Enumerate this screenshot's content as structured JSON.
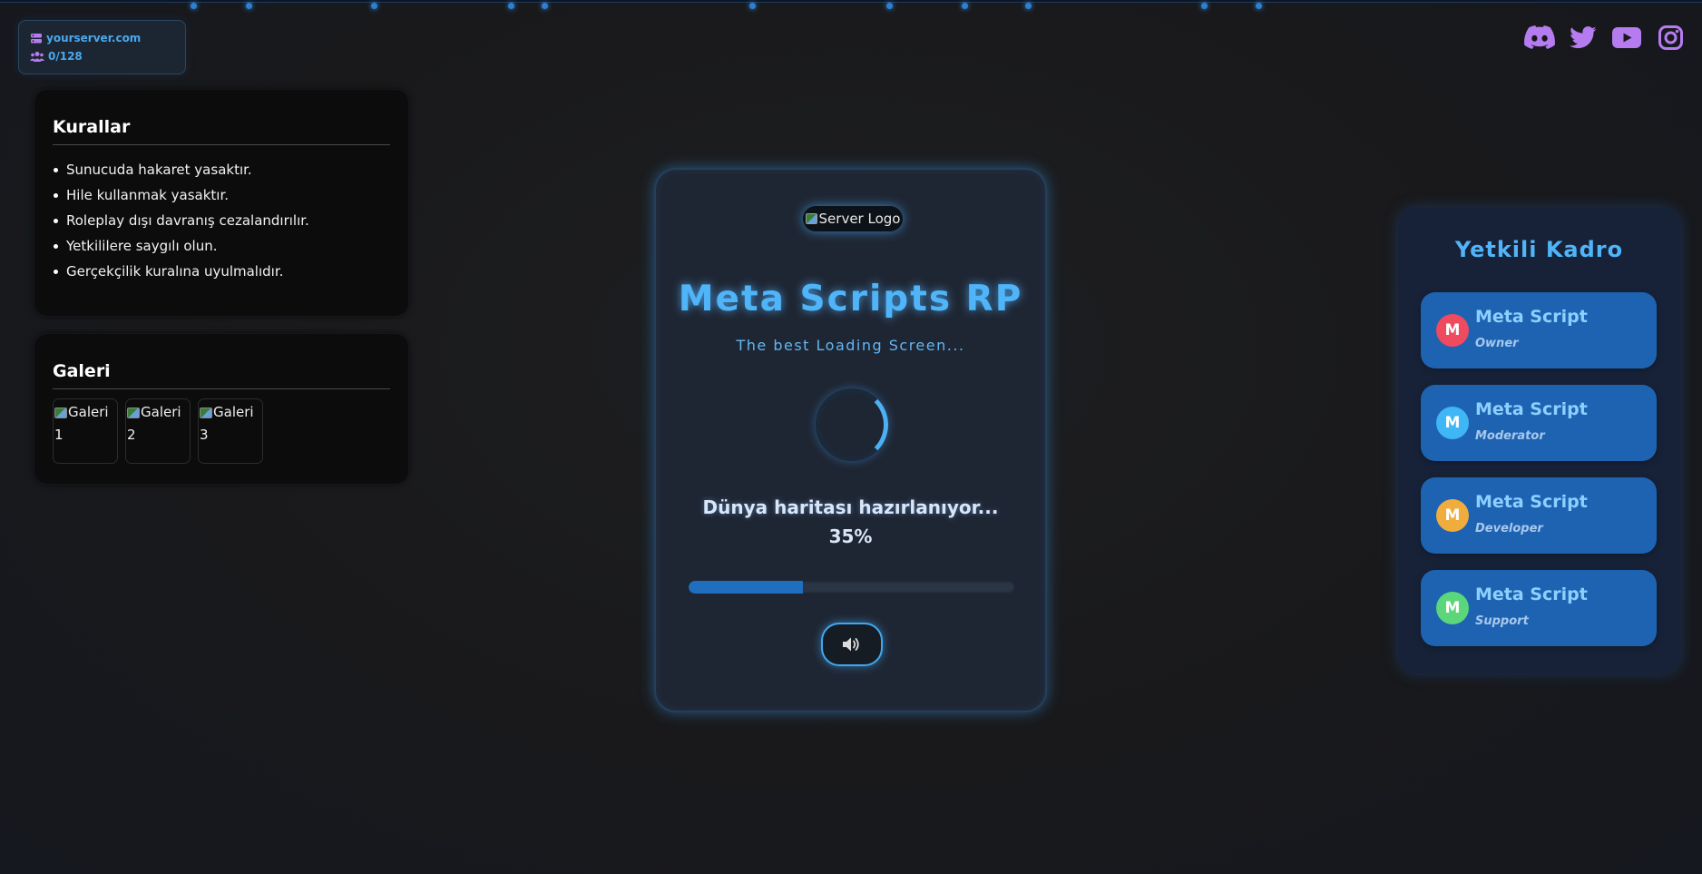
{
  "server_info": {
    "address": "yourserver.com",
    "players": "0/128"
  },
  "social": {
    "items": [
      {
        "name": "discord",
        "color": "#b57cf0"
      },
      {
        "name": "twitter",
        "color": "#b57cf0"
      },
      {
        "name": "youtube",
        "color": "#b57cf0"
      },
      {
        "name": "instagram",
        "color": "#b57cf0"
      }
    ]
  },
  "rules": {
    "title": "Kurallar",
    "items": [
      "Sunucuda hakaret yasaktır.",
      "Hile kullanmak yasaktır.",
      "Roleplay dışı davranış cezalandırılır.",
      "Yetkililere saygılı olun.",
      "Gerçekçilik kuralına uyulmalıdır."
    ]
  },
  "gallery": {
    "title": "Galeri",
    "images": [
      {
        "alt_line1": "Galeri",
        "alt_line2": "1"
      },
      {
        "alt_line1": "Galeri",
        "alt_line2": "2"
      },
      {
        "alt_line1": "Galeri",
        "alt_line2": "3"
      }
    ]
  },
  "loading": {
    "logo_alt": "Server Logo",
    "server_name": "Meta Scripts RP",
    "tagline": "The best Loading Screen...",
    "status": "Dünya haritası hazırlanıyor...",
    "percent_label": "35%",
    "progress": 0.35
  },
  "staff": {
    "title": "Yetkili Kadro",
    "members": [
      {
        "initial": "M",
        "name": "Meta Script",
        "role": "Owner",
        "color": "#f04a5e"
      },
      {
        "initial": "M",
        "name": "Meta Script",
        "role": "Moderator",
        "color": "#3fb6f6"
      },
      {
        "initial": "M",
        "name": "Meta Script",
        "role": "Developer",
        "color": "#f0ad3e"
      },
      {
        "initial": "M",
        "name": "Meta Script",
        "role": "Support",
        "color": "#5bd67a"
      }
    ]
  },
  "theme": {
    "accent": "#4fb4f8",
    "social_color": "#b57cf0"
  }
}
